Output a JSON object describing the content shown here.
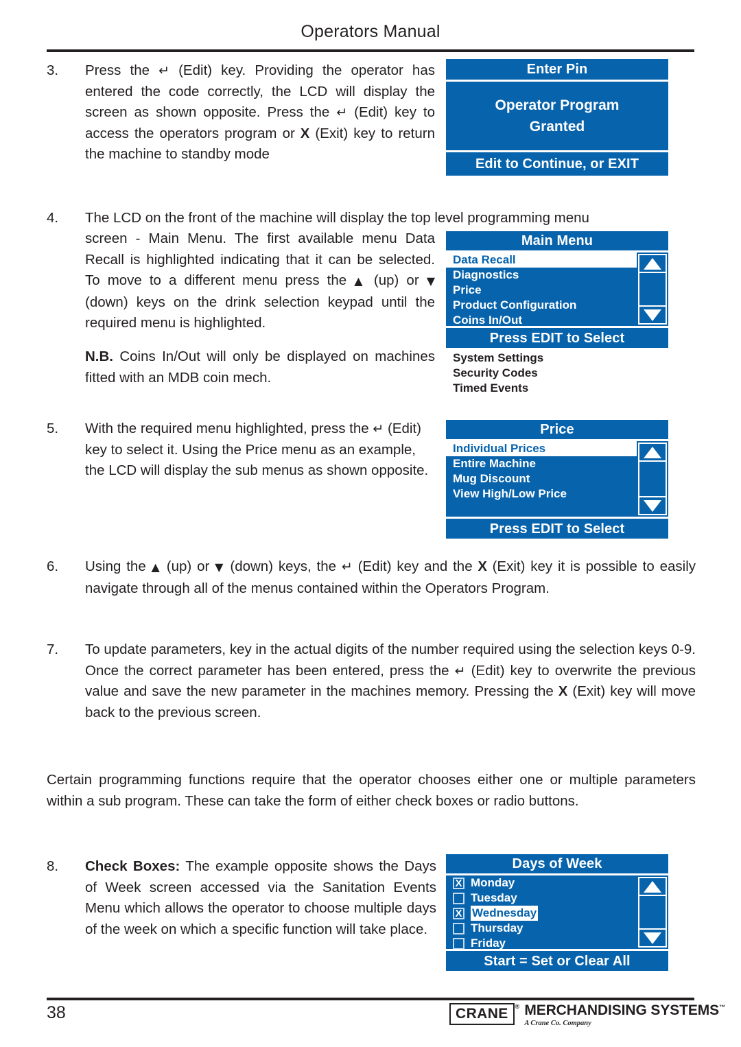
{
  "header": {
    "title": "Operators Manual"
  },
  "items": [
    {
      "number": "3.",
      "text_before": "Press the ",
      "text": "Press the ↵ (Edit) key. Providing the operator has entered the code correctly, the LCD will display the screen as shown opposite. Press the ↵ (Edit) key to access the operators program or X (Exit) key to return the machine to standby mode"
    },
    {
      "number": "4.",
      "lead": "The LCD on the front of the machine will display the top level programming menu",
      "text": "screen - Main Menu. The first available menu Data Recall is highlighted indicating that it can be selected. To move to a different menu press the ▲ (up) or ▼ (down) keys on the drink selection keypad until the required menu is highlighted.",
      "nb_label": "N.B.",
      "nb_text": " Coins In/Out will only be displayed on machines fitted with an MDB coin mech."
    },
    {
      "number": "5.",
      "text": "With the required menu highlighted, press the ↵ (Edit) key to select it. Using the Price menu as an example, the LCD will display the sub menus as shown opposite."
    },
    {
      "number": "6.",
      "text": "Using the ▲ (up) or ▼ (down) keys, the ↵ (Edit) key and the X (Exit) key it is possible to easily navigate through all of the menus contained within the Operators Program."
    },
    {
      "number": "7.",
      "text": "To update parameters, key in the actual digits of the number required using the selection keys 0-9. Once the correct parameter has been entered, press the ↵ (Edit) key to overwrite the previous value and save the new parameter in the machines memory. Pressing the X (Exit) key will move back to the previous screen."
    },
    {
      "number": "8.",
      "bold_lead": "Check Boxes:",
      "text": " The example opposite shows the Days of Week screen accessed via the Sanitation Events Menu which allows the operator to choose multiple days of the week on which a specific function will take place."
    }
  ],
  "paragraph": "Certain programming functions require that the operator chooses either one or multiple parameters within a sub program. These can take the form of either  check boxes or radio buttons.",
  "lcd_panels": {
    "enter_pin": {
      "title": "Enter Pin",
      "message_line1": "Operator Program",
      "message_line2": "Granted",
      "footer": "Edit to Continue, or EXIT"
    },
    "main_menu": {
      "title": "Main Menu",
      "rows": [
        {
          "label": "Data Recall",
          "selected": true
        },
        {
          "label": "Diagnostics",
          "selected": false
        },
        {
          "label": "Price",
          "selected": false
        },
        {
          "label": "Product Configuration",
          "selected": false
        },
        {
          "label": "Coins In/Out",
          "selected": false
        }
      ],
      "footer": "Press EDIT to Select",
      "overflow_rows": [
        "System Settings",
        "Security Codes",
        "Timed Events"
      ],
      "scroll_up_icon": "triangle-up-icon",
      "scroll_down_icon": "triangle-down-icon"
    },
    "price": {
      "title": "Price",
      "rows": [
        {
          "label": "Individual Prices",
          "selected": true
        },
        {
          "label": "Entire Machine",
          "selected": false
        },
        {
          "label": "Mug Discount",
          "selected": false
        },
        {
          "label": "View High/Low Price",
          "selected": false
        }
      ],
      "footer": "Press EDIT to Select"
    },
    "days_of_week": {
      "title": "Days of Week",
      "rows": [
        {
          "label": "Monday",
          "checked": true,
          "selected": false,
          "check_glyph": "X"
        },
        {
          "label": "Tuesday",
          "checked": false,
          "selected": false,
          "check_glyph": ""
        },
        {
          "label": "Wednesday",
          "checked": true,
          "selected": true,
          "check_glyph": "X"
        },
        {
          "label": "Thursday",
          "checked": false,
          "selected": false,
          "check_glyph": ""
        },
        {
          "label": "Friday",
          "checked": false,
          "selected": false,
          "check_glyph": ""
        }
      ],
      "footer": "Start = Set or Clear All"
    }
  },
  "footer": {
    "page_number": "38",
    "logo_box": "CRANE",
    "logo_registered": "®",
    "logo_main": "MERCHANDISING SYSTEMS",
    "logo_tm": "™",
    "logo_sub": "A Crane Co. Company"
  },
  "colors": {
    "lcd_blue": "#0763ac",
    "ink": "#231f20",
    "lcd_white": "#ffffff"
  }
}
